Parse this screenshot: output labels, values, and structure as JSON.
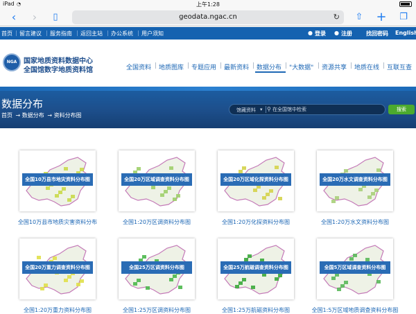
{
  "status": {
    "carrier": "iPad",
    "time": "上午1:28"
  },
  "browser": {
    "url": "geodata.ngac.cn"
  },
  "top_nav": {
    "left": [
      "首页",
      "留言建议",
      "服务指南",
      "返回主站",
      "办公系统",
      "用户须知"
    ],
    "login": "登录",
    "register": "注册",
    "forgot": "找回密码",
    "english": "English"
  },
  "header": {
    "logo_badge": "NGA",
    "title1": "国家地质资料数据中心",
    "title2": "全国馆数字地质资料馆",
    "nav": [
      "全国资料",
      "地质图库",
      "专题应用",
      "最新资料",
      "数据分布",
      "\"大数据\"",
      "资源共享",
      "地质在线",
      "互联互查"
    ],
    "active_nav": "数据分布"
  },
  "banner": {
    "title": "数据分布",
    "breadcrumb": [
      "首页",
      "→ 数据分布",
      "→ 资料分布图"
    ],
    "search_scope": "馆藏资料",
    "search_placeholder": "在全国馆中检索",
    "search_button": "搜索"
  },
  "cards": [
    {
      "band": "全国10万县市地灾资料分布图",
      "caption": "全国10万县市地质灾害资料分布",
      "accent": "#c9d94a"
    },
    {
      "band": "全国20万区域调查资料分布图",
      "caption": "全国1:20万区调资料分布图",
      "accent": "#9fcf6a"
    },
    {
      "band": "全国20万区域化探资料分布图",
      "caption": "全国1:20万化探资料分布图",
      "accent": "#d4d34a"
    },
    {
      "band": "全国20万水文调查资料分布图",
      "caption": "全国1:20万水文资料分布图",
      "accent": "#a8cf7a"
    },
    {
      "band": "全国20万重力调查资料分布图",
      "caption": "全国1:20万重力资料分布图",
      "accent": "#e0e04a"
    },
    {
      "band": "全国25万区调资料分布图",
      "caption": "全国1:25万区调资料分布图",
      "accent": "#4cb84c"
    },
    {
      "band": "全国25万航磁调查资料分布图",
      "caption": "全国1:25万航磁资料分布图",
      "accent": "#3aa83a"
    },
    {
      "band": "全国5万区域调查资料分布图",
      "caption": "全国1:5万区域地质调查资料分布图",
      "accent": "#5ab85a"
    }
  ]
}
